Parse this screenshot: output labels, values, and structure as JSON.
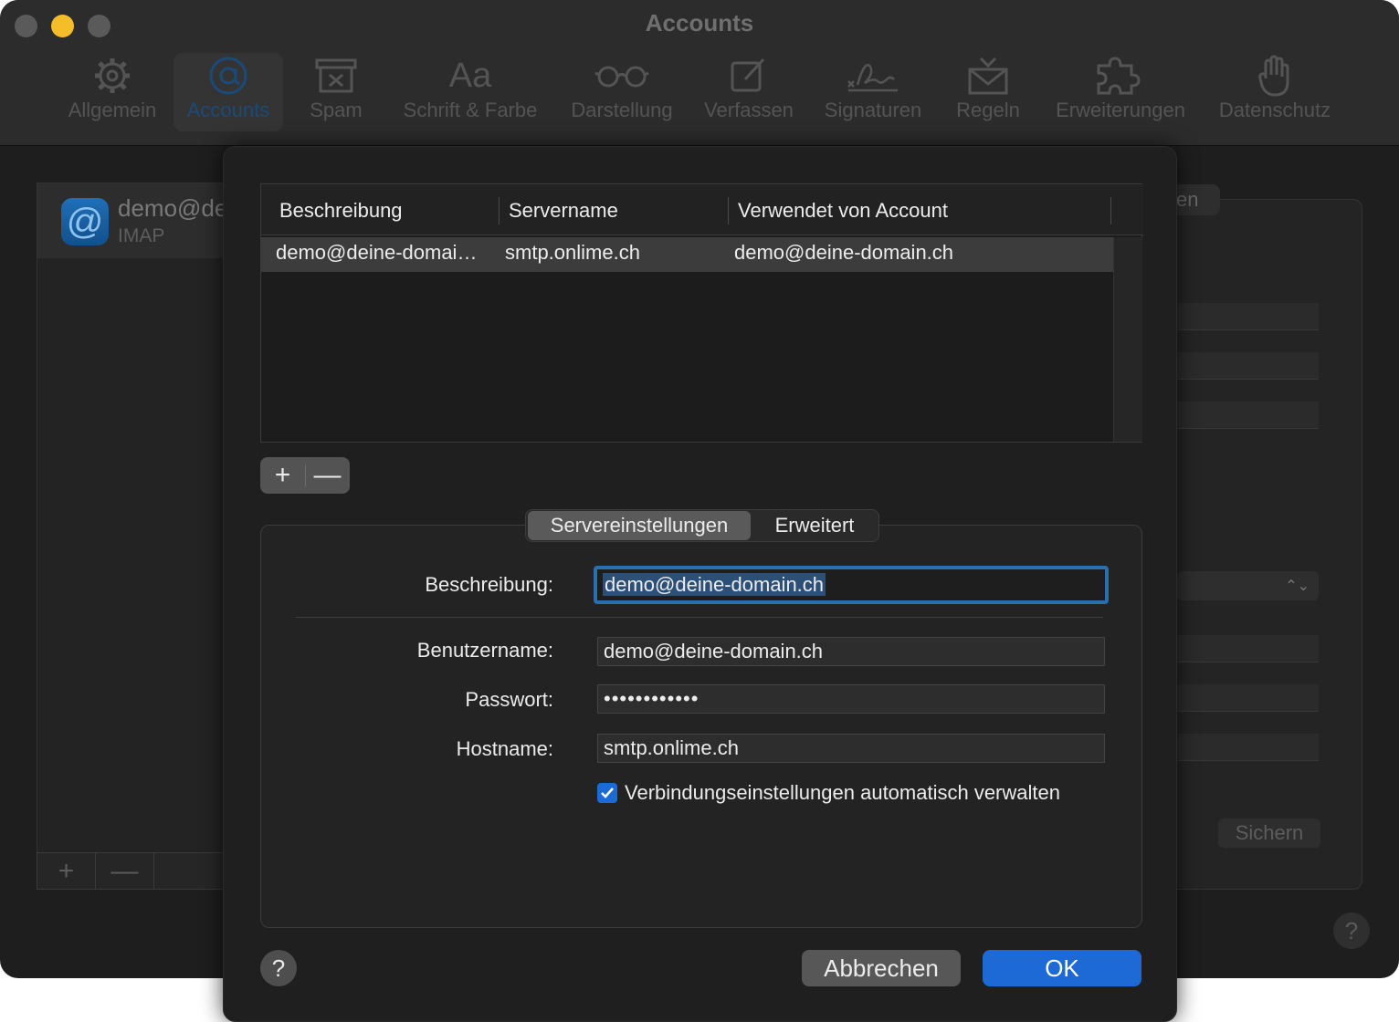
{
  "window": {
    "title": "Accounts",
    "traffic_lights": [
      "#5a5a5a",
      "#f6bd2a",
      "#5a5a5a"
    ]
  },
  "toolbar": {
    "items": [
      {
        "label": "Allgemein",
        "icon": "gear-icon"
      },
      {
        "label": "Accounts",
        "icon": "at-icon"
      },
      {
        "label": "Spam",
        "icon": "junk-icon"
      },
      {
        "label": "Schrift & Farbe",
        "icon": "font-icon"
      },
      {
        "label": "Darstellung",
        "icon": "glasses-icon"
      },
      {
        "label": "Verfassen",
        "icon": "compose-icon"
      },
      {
        "label": "Signaturen",
        "icon": "signature-icon"
      },
      {
        "label": "Regeln",
        "icon": "rules-icon"
      },
      {
        "label": "Erweiterungen",
        "icon": "puzzle-icon"
      },
      {
        "label": "Datenschutz",
        "icon": "hand-icon"
      }
    ]
  },
  "account_list": {
    "selected": {
      "name": "demo@de",
      "type": "IMAP"
    },
    "add_symbol": "+",
    "remove_symbol": "—"
  },
  "background": {
    "tab_fragment": "en",
    "save_label": "Sichern",
    "help_symbol": "?"
  },
  "sheet": {
    "table": {
      "columns": [
        "Beschreibung",
        "Servername",
        "Verwendet von Account"
      ],
      "rows": [
        [
          "demo@deine-domai…",
          "smtp.onlime.ch",
          "demo@deine-domain.ch"
        ]
      ]
    },
    "add_symbol": "+",
    "remove_symbol": "—",
    "tabs": [
      "Servereinstellungen",
      "Erweitert"
    ],
    "selected_tab": "Servereinstellungen",
    "form": {
      "description_label": "Beschreibung:",
      "description_value": "demo@deine-domain.ch",
      "username_label": "Benutzername:",
      "username_value": "demo@deine-domain.ch",
      "password_label": "Passwort:",
      "password_value": "••••••••••••",
      "hostname_label": "Hostname:",
      "hostname_value": "smtp.onlime.ch",
      "auto_manage_label": "Verbindungseinstellungen automatisch verwalten",
      "auto_manage_checked": true
    },
    "help_symbol": "?",
    "cancel_label": "Abbrechen",
    "ok_label": "OK",
    "accent_color": "#1d6ad6"
  }
}
